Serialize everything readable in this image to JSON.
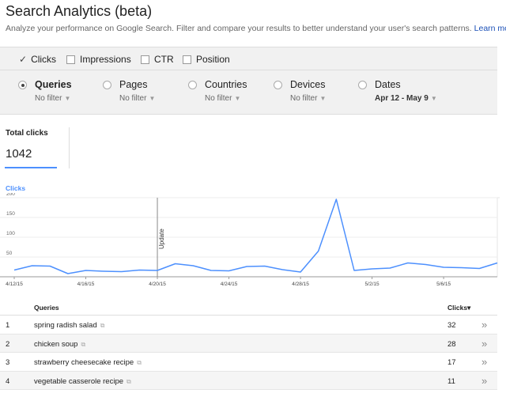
{
  "header": {
    "title": "Search Analytics (beta)",
    "description": "Analyze your performance on Google Search. Filter and compare your results to better understand your user's search patterns.",
    "learn_more": "Learn more."
  },
  "metrics": [
    {
      "label": "Clicks",
      "checked": true
    },
    {
      "label": "Impressions",
      "checked": false
    },
    {
      "label": "CTR",
      "checked": false
    },
    {
      "label": "Position",
      "checked": false
    }
  ],
  "dimensions": [
    {
      "label": "Queries",
      "filter": "No filter",
      "selected": true
    },
    {
      "label": "Pages",
      "filter": "No filter",
      "selected": false
    },
    {
      "label": "Countries",
      "filter": "No filter",
      "selected": false
    },
    {
      "label": "Devices",
      "filter": "No filter",
      "selected": false
    },
    {
      "label": "Dates",
      "filter": "Apr 12 - May 9",
      "selected": false
    }
  ],
  "totals": {
    "label": "Total clicks",
    "value": "1042"
  },
  "chart_data": {
    "type": "line",
    "title": "Clicks",
    "x": [
      "4/12/15",
      "4/13/15",
      "4/14/15",
      "4/15/15",
      "4/16/15",
      "4/17/15",
      "4/18/15",
      "4/19/15",
      "4/20/15",
      "4/21/15",
      "4/22/15",
      "4/23/15",
      "4/24/15",
      "4/25/15",
      "4/26/15",
      "4/27/15",
      "4/28/15",
      "4/29/15",
      "4/30/15",
      "5/1/15",
      "5/2/15",
      "5/3/15",
      "5/4/15",
      "5/5/15",
      "5/6/15",
      "5/7/15",
      "5/8/15",
      "5/9/15"
    ],
    "x_tick_labels": [
      "4/12/15",
      "4/16/15",
      "4/20/15",
      "4/24/15",
      "4/28/15",
      "5/2/15",
      "5/6/15"
    ],
    "series": [
      {
        "name": "Clicks",
        "color": "#4d90fe",
        "values": [
          17,
          28,
          27,
          8,
          16,
          14,
          13,
          17,
          16,
          33,
          28,
          16,
          15,
          26,
          27,
          18,
          12,
          65,
          196,
          16,
          20,
          22,
          35,
          31,
          24,
          23,
          21,
          35
        ]
      }
    ],
    "yticks": [
      50,
      100,
      150,
      200
    ],
    "ylim": [
      0,
      200
    ],
    "annotation": {
      "x": "4/20/15",
      "label": "Update"
    },
    "grid": true
  },
  "table": {
    "col_query": "Queries",
    "col_clicks": "Clicks",
    "sort_indicator": "▾",
    "rows": [
      {
        "n": "1",
        "query": "spring radish salad",
        "clicks": "32"
      },
      {
        "n": "2",
        "query": "chicken soup",
        "clicks": "28"
      },
      {
        "n": "3",
        "query": "strawberry cheesecake recipe",
        "clicks": "17"
      },
      {
        "n": "4",
        "query": "vegetable casserole recipe",
        "clicks": "11"
      }
    ]
  },
  "icons": {
    "external": "external-link-icon",
    "row_action": "double-chevron-right-icon",
    "check": "checkmark-icon"
  }
}
